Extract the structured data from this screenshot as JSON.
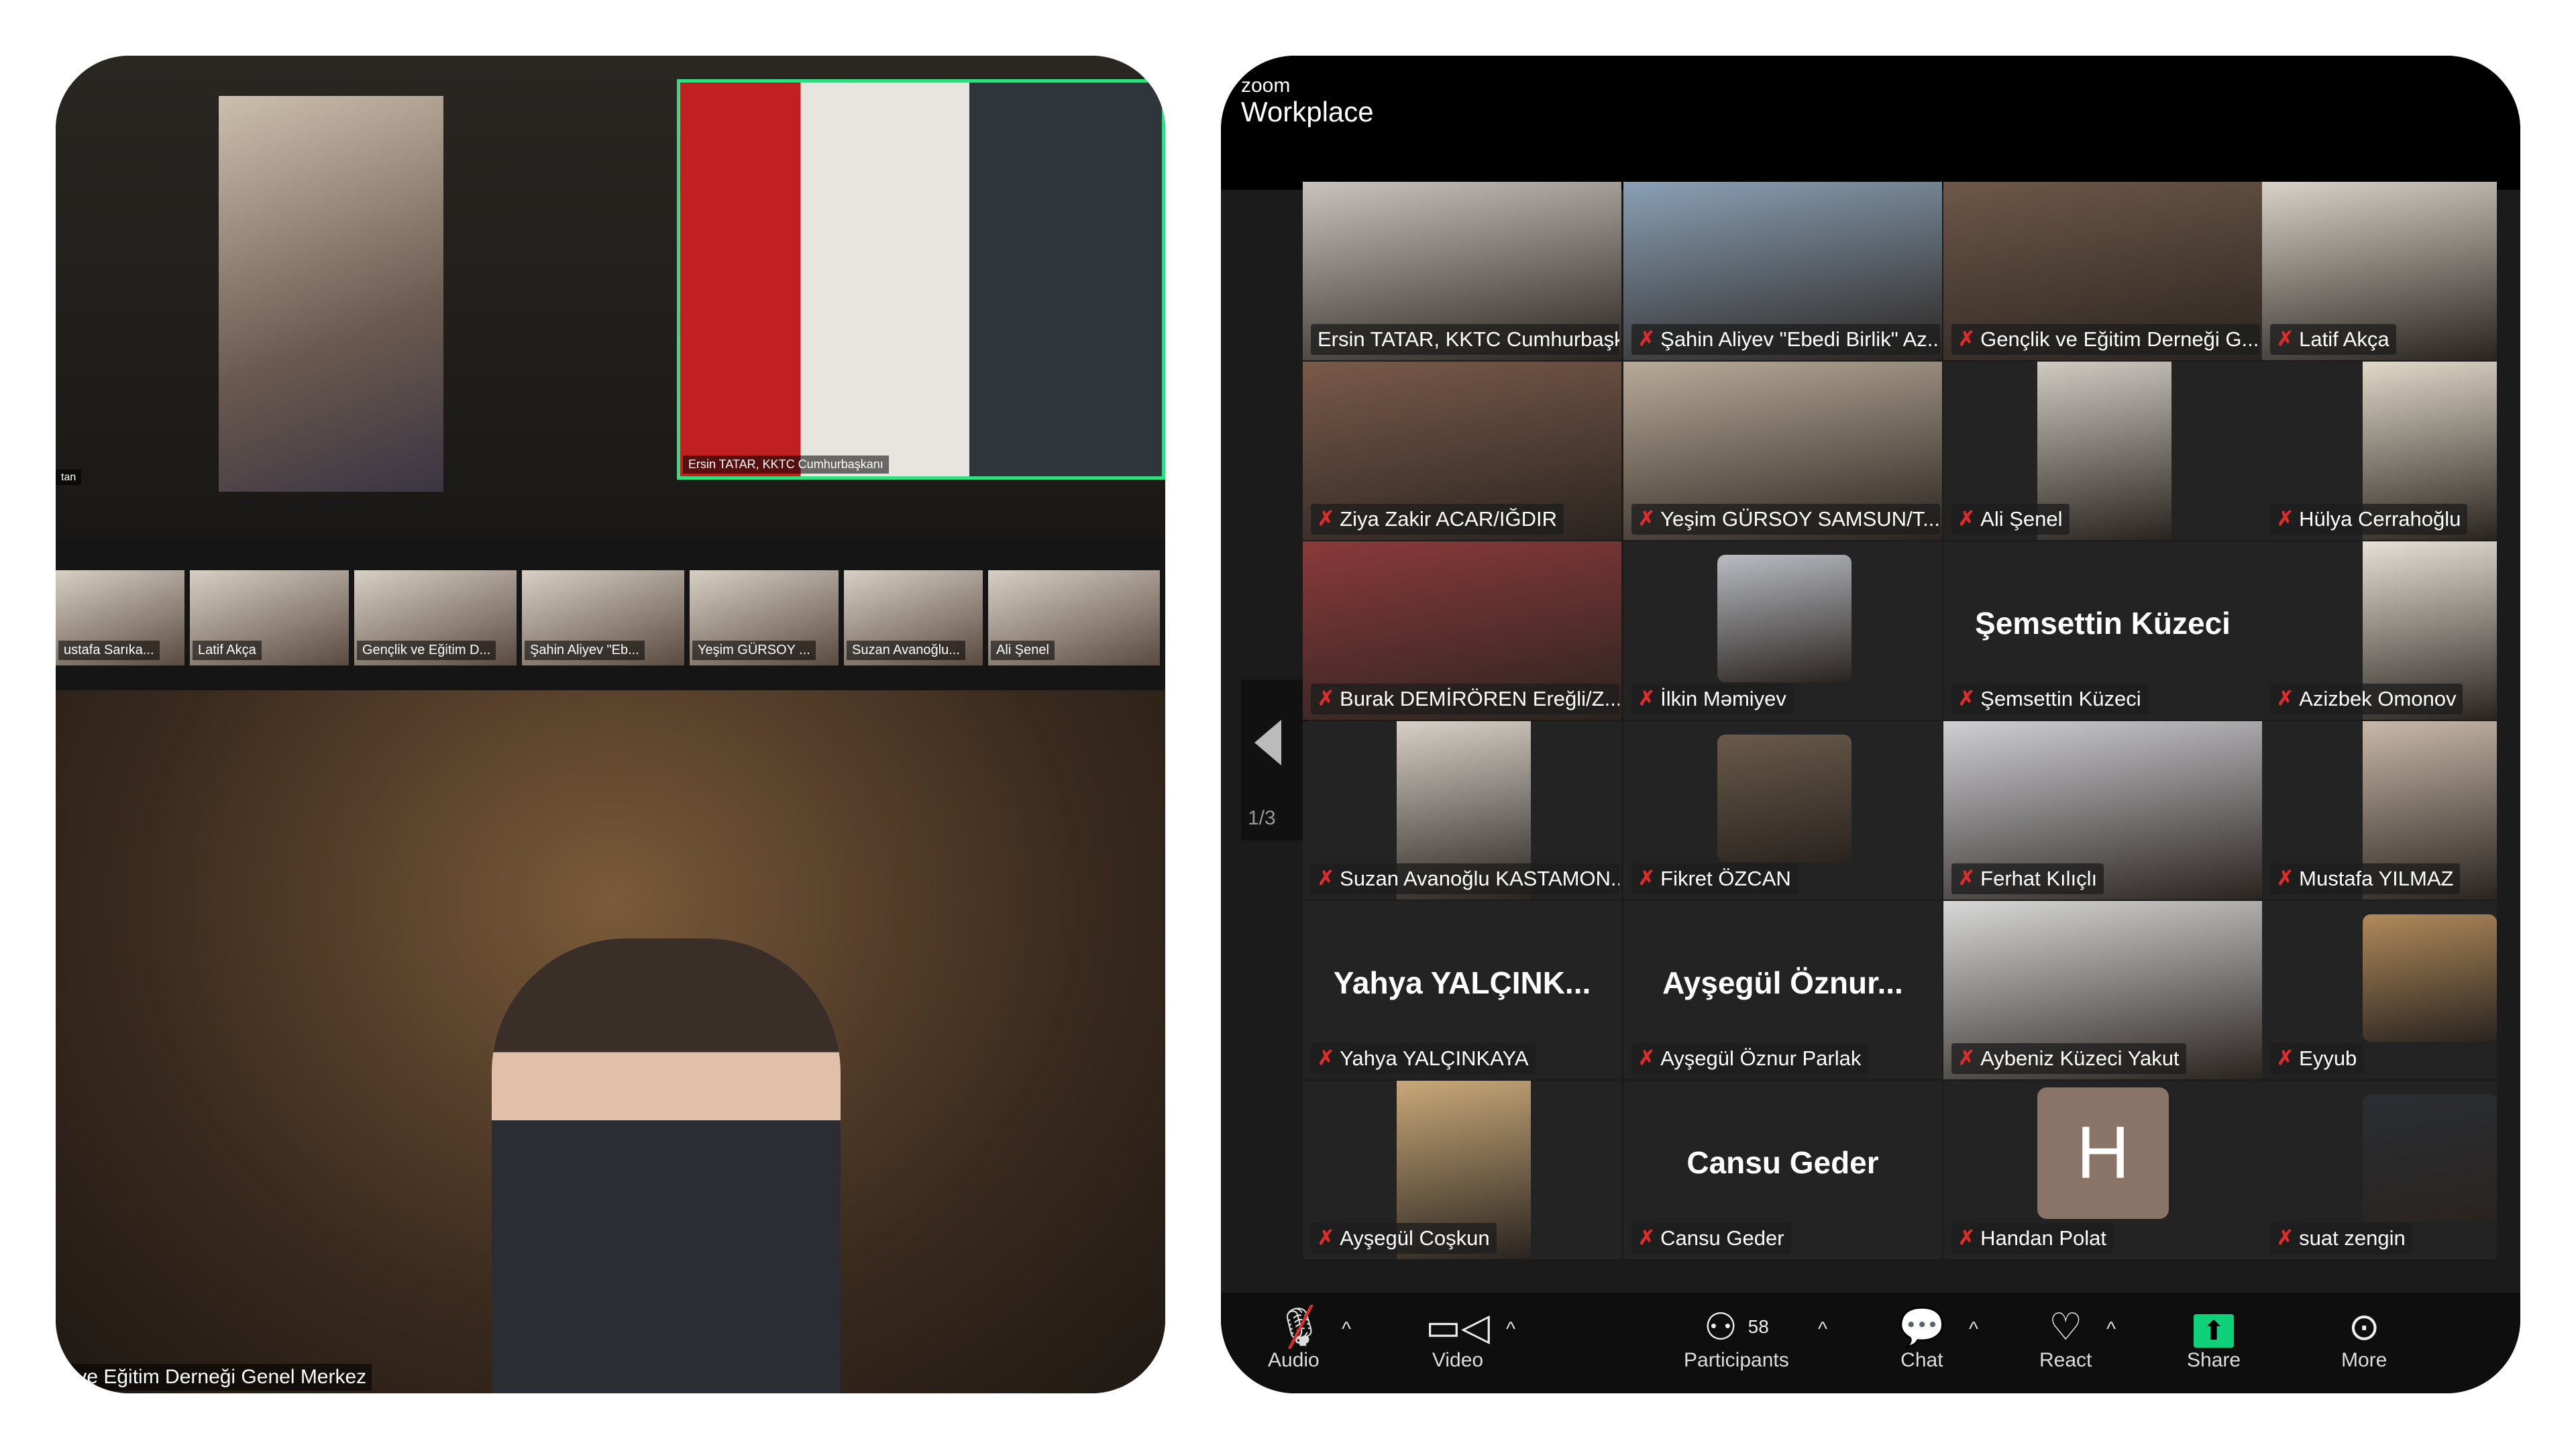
{
  "left_photo": {
    "presenter_label": "Ersin TATAR, KKTC Cumhurbaşkanı",
    "edge_label": "tan",
    "strip": [
      {
        "name": "ustafa Sarıka..."
      },
      {
        "name": "Latif Akça"
      },
      {
        "name": "Gençlik ve Eğitim D..."
      },
      {
        "name": "Şahin Aliyev \"Eb..."
      },
      {
        "name": "Yeşim GÜRSOY ..."
      },
      {
        "name": "Suzan Avanoğlu..."
      },
      {
        "name": "Ali Şenel"
      }
    ],
    "room_label": "k ve Eğitim Derneği Genel Merkez"
  },
  "app": {
    "brand": "zoom",
    "product": "Workplace"
  },
  "pager": {
    "page": "1/3"
  },
  "tiles": [
    {
      "name": "Ersin TATAR, KKTC Cumhurbaşk...",
      "muted": false,
      "active": true,
      "kind": "video",
      "bg": "#c9c3bd"
    },
    {
      "name": "Şahin Aliyev \"Ebedi Birlik\" Az...",
      "muted": true,
      "kind": "video",
      "bg": "#8aa0b5"
    },
    {
      "name": "Gençlik ve Eğitim Derneği G...",
      "muted": true,
      "kind": "video",
      "bg": "#6e5848"
    },
    {
      "name": "Latif Akça",
      "muted": true,
      "kind": "video",
      "bg": "#d8d2c8"
    },
    {
      "name": "Ziya Zakir ACAR/IĞDIR",
      "muted": true,
      "kind": "video",
      "bg": "#7a5a4a"
    },
    {
      "name": "Yeşim GÜRSOY  SAMSUN/T...",
      "muted": true,
      "kind": "video",
      "bg": "#b8aa98"
    },
    {
      "name": "Ali Şenel",
      "muted": true,
      "kind": "video-narrow",
      "bg": "#cfcac2"
    },
    {
      "name": "Hülya Cerrahoğlu",
      "muted": true,
      "kind": "video-narrow-right",
      "bg": "#e0d8c8"
    },
    {
      "name": "Burak DEMİRÖREN Ereğli/Z...",
      "muted": true,
      "kind": "video",
      "bg": "#8a3a3a"
    },
    {
      "name": "İlkin Məmiyev",
      "muted": true,
      "kind": "video-small",
      "bg": "#b9bcc2"
    },
    {
      "name": "Şemsettin Küzeci",
      "muted": true,
      "kind": "namecard",
      "card": "Şemsettin Küzeci"
    },
    {
      "name": "Azizbek Omonov",
      "muted": true,
      "kind": "video-narrow-right",
      "bg": "#e6e0d6"
    },
    {
      "name": "Suzan Avanoğlu KASTAMON...",
      "muted": true,
      "kind": "video-narrow",
      "bg": "#d6d0c8"
    },
    {
      "name": "Fikret ÖZCAN",
      "muted": true,
      "kind": "video-small",
      "bg": "#6a5a4a"
    },
    {
      "name": "Ferhat Kılıçlı",
      "muted": true,
      "kind": "video",
      "bg": "#cfcfd4"
    },
    {
      "name": "Mustafa YILMAZ",
      "muted": true,
      "kind": "video-narrow-right",
      "bg": "#c8b8a8"
    },
    {
      "name": "Yahya YALÇINKAYA",
      "muted": true,
      "kind": "namecard",
      "card": "Yahya  YALÇINK..."
    },
    {
      "name": "Ayşegül Öznur Parlak",
      "muted": true,
      "kind": "namecard",
      "card": "Ayşegül  Öznur..."
    },
    {
      "name": "Aybeniz Küzeci Yakut",
      "muted": true,
      "kind": "video",
      "bg": "#d8d8d8"
    },
    {
      "name": "Eyyub",
      "muted": true,
      "kind": "video-small-right",
      "bg": "#b08a5a"
    },
    {
      "name": "Ayşegül Coşkun",
      "muted": true,
      "kind": "video-narrow",
      "bg": "#c8a878"
    },
    {
      "name": "Cansu Geder",
      "muted": true,
      "kind": "namecard",
      "card": "Cansu Geder"
    },
    {
      "name": "Handan Polat",
      "muted": true,
      "kind": "avatar",
      "initial": "H"
    },
    {
      "name": "suat zengin",
      "muted": true,
      "kind": "video-small-right",
      "bg": "#2a2e33"
    }
  ],
  "toolbar": {
    "audio": {
      "label": "Audio",
      "icon": "mic-muted-icon"
    },
    "video": {
      "label": "Video",
      "icon": "video-camera-icon"
    },
    "participants": {
      "label": "Participants",
      "count": "58",
      "icon": "participants-icon"
    },
    "chat": {
      "label": "Chat",
      "icon": "chat-icon"
    },
    "react": {
      "label": "React",
      "icon": "heart-icon"
    },
    "share": {
      "label": "Share",
      "icon": "share-screen-icon",
      "color": "#0fd17a"
    },
    "more": {
      "label": "More",
      "icon": "more-icon"
    },
    "caret": "^"
  },
  "colors": {
    "active_speaker": "#2ee07f",
    "muted": "#e02b2b",
    "avatar": "#8a7468"
  }
}
